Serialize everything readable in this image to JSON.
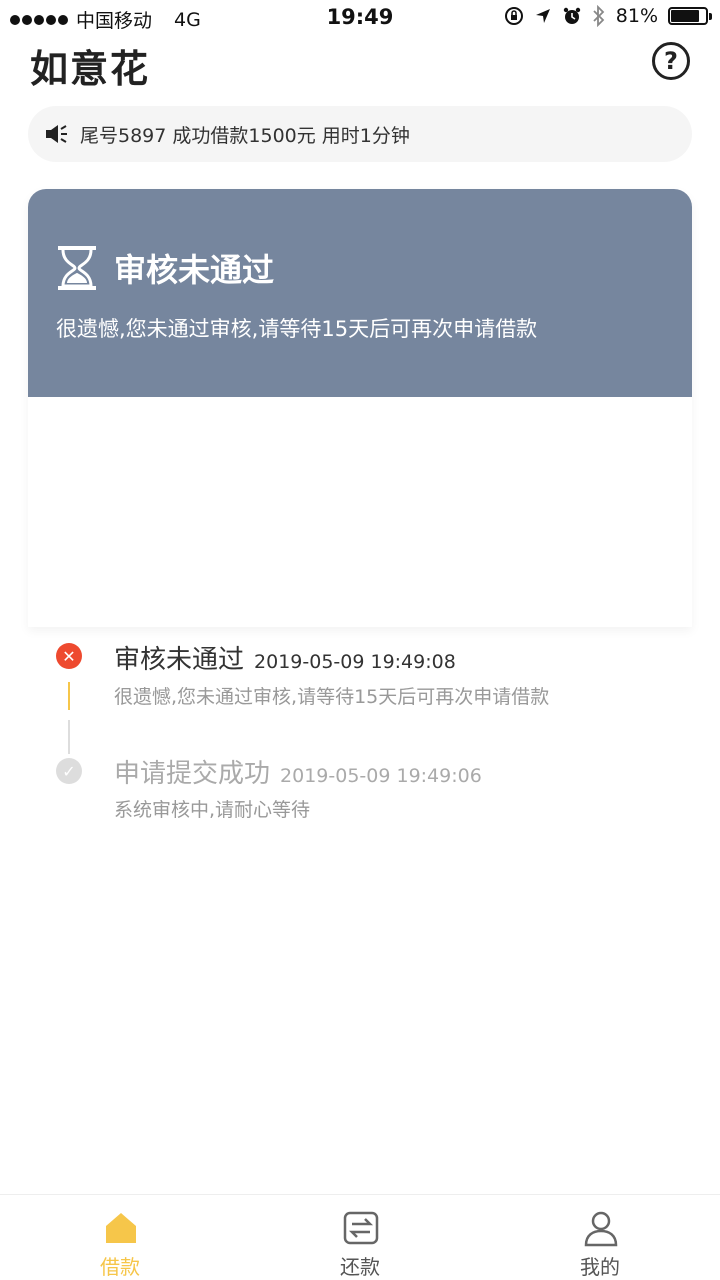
{
  "status_bar": {
    "carrier": "中国移动",
    "network": "4G",
    "time": "19:49",
    "battery_percent": "81%",
    "battery_level": 0.81
  },
  "header": {
    "title": "如意花",
    "help_icon": "help-icon"
  },
  "notice": {
    "text": "尾号5897 成功借款1500元 用时1分钟",
    "icon": "speaker-icon"
  },
  "status_card": {
    "title": "审核未通过",
    "description": "很遗憾,您未通过审核,请等待15天后可再次申请借款",
    "icon": "hourglass-icon",
    "bg_color": "#76869e"
  },
  "timeline": [
    {
      "title": "审核未通过",
      "time": "2019-05-09 19:49:08",
      "description": "很遗憾,您未通过审核,请等待15天后可再次申请借款",
      "status": "failed",
      "color": "#ee4a2f"
    },
    {
      "title": "申请提交成功",
      "time": "2019-05-09 19:49:06",
      "description": "系统审核中,请耐心等待",
      "status": "done",
      "color": "#dddddd"
    }
  ],
  "tabbar": {
    "active_color": "#f6c64a",
    "inactive_color": "#555555",
    "items": [
      {
        "label": "借款",
        "icon": "home-icon",
        "active": true
      },
      {
        "label": "还款",
        "icon": "repay-icon",
        "active": false
      },
      {
        "label": "我的",
        "icon": "user-icon",
        "active": false
      }
    ]
  }
}
